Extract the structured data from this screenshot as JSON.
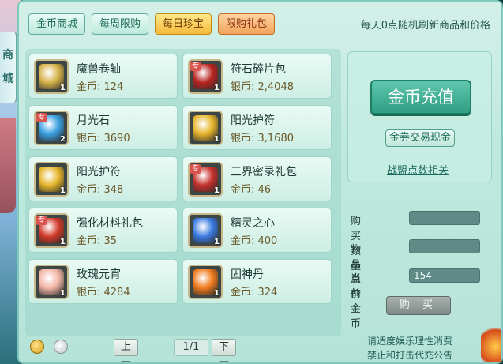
{
  "side": {
    "scroll_chars": [
      "商",
      "城"
    ]
  },
  "tabs": [
    {
      "label": "金币商城",
      "state": "normal"
    },
    {
      "label": "每周限购",
      "state": "normal"
    },
    {
      "label": "每日珍宝",
      "state": "active"
    },
    {
      "label": "限购礼包",
      "state": "limit"
    }
  ],
  "refresh_note": "每天0点随机刷新商品和价格",
  "items": [
    {
      "name": "魔兽卷轴",
      "price": "金币: 124",
      "qty": "1",
      "tag": "",
      "icon": "scroll-icon",
      "color": "#d7b24a"
    },
    {
      "name": "符石碎片包",
      "price": "银币: 2,4048",
      "qty": "1",
      "tag": "专",
      "icon": "rune-bag-icon",
      "color": "#b8231f"
    },
    {
      "name": "月光石",
      "price": "银币: 3690",
      "qty": "2",
      "tag": "专",
      "icon": "moonstone-icon",
      "color": "#3aa0e0"
    },
    {
      "name": "阳光护符",
      "price": "银币: 3,1680",
      "qty": "1",
      "tag": "",
      "icon": "sun-amulet-icon",
      "color": "#e6b52c"
    },
    {
      "name": "阳光护符",
      "price": "金币: 348",
      "qty": "1",
      "tag": "",
      "icon": "sun-amulet-icon",
      "color": "#e6b52c"
    },
    {
      "name": "三界密录礼包",
      "price": "金币: 46",
      "qty": "1",
      "tag": "专",
      "icon": "gift-bag-icon",
      "color": "#c4322b"
    },
    {
      "name": "强化材料礼包",
      "price": "金币: 35",
      "qty": "1",
      "tag": "专",
      "icon": "material-bag-icon",
      "color": "#d23a2a"
    },
    {
      "name": "精灵之心",
      "price": "金币: 400",
      "qty": "1",
      "tag": "",
      "icon": "spirit-heart-icon",
      "color": "#3a7ae0"
    },
    {
      "name": "玫瑰元宵",
      "price": "银币: 4284",
      "qty": "1",
      "tag": "",
      "icon": "rose-dumpling-icon",
      "color": "#f2b6a6"
    },
    {
      "name": "固神丹",
      "price": "金币: 324",
      "qty": "1",
      "tag": "",
      "icon": "pill-icon",
      "color": "#f07a1c"
    }
  ],
  "right": {
    "recharge": "金币充值",
    "exchange": "金券交易现金",
    "guild_link": "战盟点数相关"
  },
  "form": {
    "buy_qty_label": "购买数量",
    "buy_qty_value": "",
    "total_label": "物品总价",
    "total_value": "",
    "current_gold_label": "当前金币",
    "current_gold_value": "154"
  },
  "buy_button": "购 买",
  "pager": {
    "prev": "上一页",
    "page": "1/1",
    "next": "下一页"
  },
  "notice": [
    "请适度娱乐理性消费",
    "禁止和打击代充公告"
  ]
}
